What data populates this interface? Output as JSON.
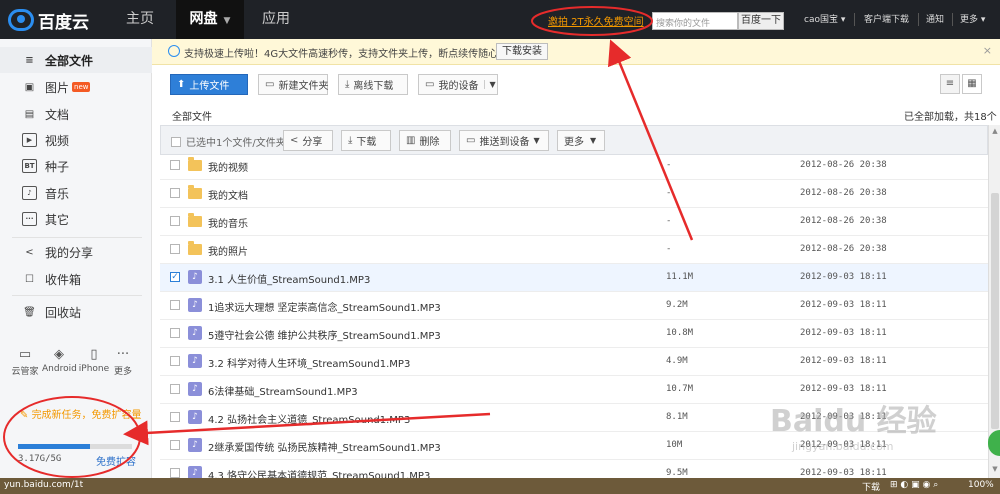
{
  "topnav": {
    "logo": "百度云",
    "tabs": [
      {
        "label": "主页"
      },
      {
        "label": "网盘",
        "caret": "▼"
      },
      {
        "label": "应用"
      }
    ],
    "promo_link": "邀拍 2T永久免费空间",
    "search_placeholder": "搜索你的文件",
    "search_button": "百度一下",
    "user": "cao国宝 ▾",
    "client_download": "客户端下载",
    "notifications": "通知",
    "more": "更多 ▾"
  },
  "sidebar": {
    "items": [
      {
        "label": "全部文件",
        "icon": "list-icon",
        "glyph": "≡"
      },
      {
        "label": "图片",
        "icon": "image-icon",
        "glyph": "▣",
        "badge": "new"
      },
      {
        "label": "文档",
        "icon": "document-icon",
        "glyph": "▤"
      },
      {
        "label": "视频",
        "icon": "video-icon",
        "glyph": "▶"
      },
      {
        "label": "种子",
        "icon": "bt-icon",
        "glyph": "BT"
      },
      {
        "label": "音乐",
        "icon": "music-icon",
        "glyph": "♪"
      },
      {
        "label": "其它",
        "icon": "other-icon",
        "glyph": "···"
      },
      {
        "label": "我的分享",
        "icon": "share-icon",
        "glyph": "<"
      },
      {
        "label": "收件箱",
        "icon": "inbox-icon",
        "glyph": "☐"
      },
      {
        "label": "回收站",
        "icon": "trash-icon",
        "glyph": "🗑"
      }
    ],
    "devices": [
      {
        "label": "云管家",
        "icon": "monitor-icon",
        "glyph": "▭"
      },
      {
        "label": "Android",
        "icon": "android-icon",
        "glyph": "◈"
      },
      {
        "label": "iPhone",
        "icon": "iphone-icon",
        "glyph": "▯"
      },
      {
        "label": "更多",
        "icon": "more-dots-icon",
        "glyph": "···"
      }
    ],
    "task_tip": "完成新任务，免费扩容量",
    "quota_text": "3.17G/5G",
    "quota_fraction": 0.634,
    "quota_link": "免费扩容"
  },
  "notice": {
    "text": "支持极速上传啦！4G大文件高速秒传，支持文件夹上传，断点续传随心所欲！",
    "button": "下载安装",
    "close": "×"
  },
  "toolbar": {
    "upload": "上传文件",
    "new_folder": "新建文件夹",
    "offline_download": "离线下载",
    "my_devices": "我的设备"
  },
  "breadcrumb": "全部文件",
  "loaded_info": "已全部加载，共18个",
  "action_bar": {
    "selection": "已选中1个文件/文件夹",
    "share": "分享",
    "download": "下载",
    "delete": "删除",
    "push": "推送到设备",
    "more": "更多"
  },
  "files": [
    {
      "name": "我的视频",
      "type": "folder",
      "size": "-",
      "date": "2012-08-26 20:38",
      "checked": false
    },
    {
      "name": "我的文档",
      "type": "folder",
      "size": "-",
      "date": "2012-08-26 20:38",
      "checked": false
    },
    {
      "name": "我的音乐",
      "type": "folder",
      "size": "-",
      "date": "2012-08-26 20:38",
      "checked": false
    },
    {
      "name": "我的照片",
      "type": "folder",
      "size": "-",
      "date": "2012-08-26 20:38",
      "checked": false
    },
    {
      "name": "3.1 人生价值_StreamSound1.MP3",
      "type": "music",
      "size": "11.1M",
      "date": "2012-09-03 18:11",
      "checked": true
    },
    {
      "name": "1追求远大理想 坚定崇高信念_StreamSound1.MP3",
      "type": "music",
      "size": "9.2M",
      "date": "2012-09-03 18:11",
      "checked": false
    },
    {
      "name": "5遵守社会公德 维护公共秩序_StreamSound1.MP3",
      "type": "music",
      "size": "10.8M",
      "date": "2012-09-03 18:11",
      "checked": false
    },
    {
      "name": "3.2 科学对待人生环境_StreamSound1.MP3",
      "type": "music",
      "size": "4.9M",
      "date": "2012-09-03 18:11",
      "checked": false
    },
    {
      "name": "6法律基础_StreamSound1.MP3",
      "type": "music",
      "size": "10.7M",
      "date": "2012-09-03 18:11",
      "checked": false
    },
    {
      "name": "4.2 弘扬社会主义道德_StreamSound1.MP3",
      "type": "music",
      "size": "8.1M",
      "date": "2012-09-03 18:11",
      "checked": false
    },
    {
      "name": "2继承爱国传统 弘扬民族精神_StreamSound1.MP3",
      "type": "music",
      "size": "10M",
      "date": "2012-09-03 18:11",
      "checked": false
    },
    {
      "name": "4.3 恪守公民基本道德规范_StreamSound1.MP3",
      "type": "music",
      "size": "9.5M",
      "date": "2012-09-03 18:11",
      "checked": false
    }
  ],
  "statusbar": {
    "url": "yun.baidu.com/1t",
    "download": "下载",
    "zoom": "100%"
  },
  "watermark": {
    "main": "Baidu 经验",
    "sub": "jingyan.baidu.com"
  },
  "colors": {
    "accent": "#2e7fd8",
    "promo": "#f39800",
    "annotation": "#e62b2b"
  }
}
